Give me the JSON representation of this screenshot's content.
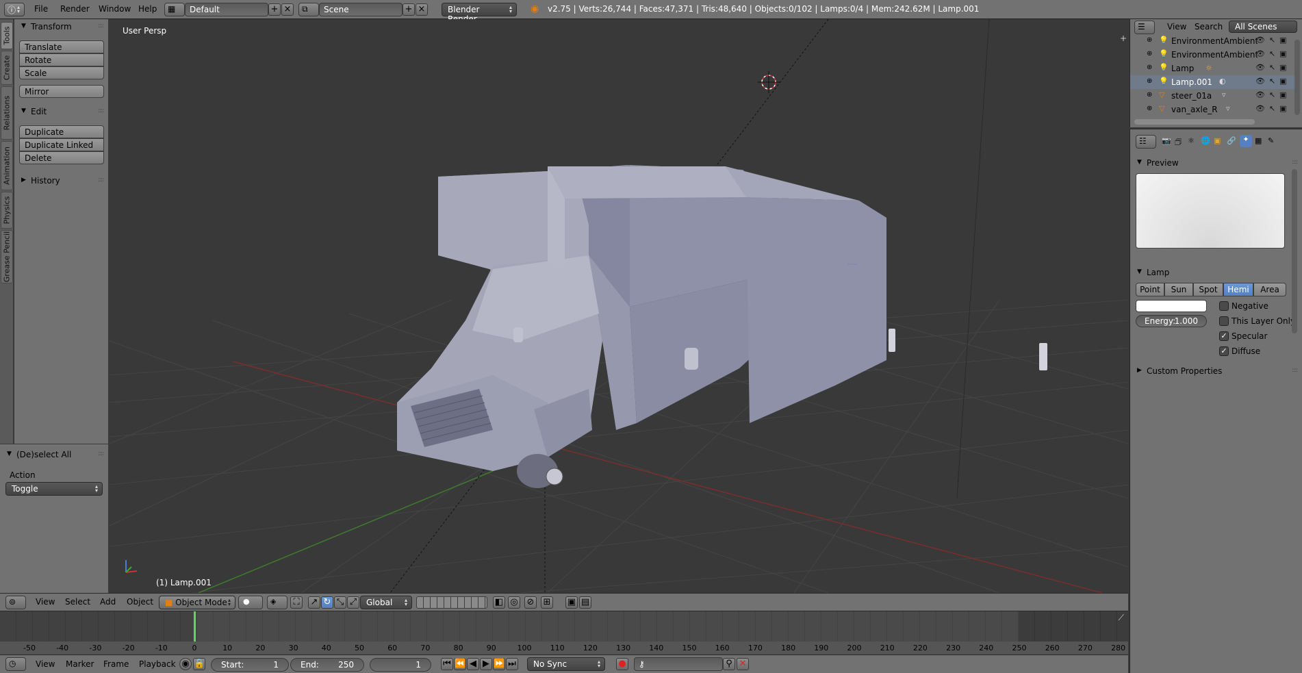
{
  "topbar": {
    "menus": [
      "File",
      "Render",
      "Window",
      "Help"
    ],
    "screen_layout": "Default",
    "scene": "Scene",
    "engine": "Blender Render",
    "stats": "v2.75 | Verts:26,744 | Faces:47,371 | Tris:48,640 | Objects:0/102 | Lamps:0/4 | Mem:242.62M | Lamp.001"
  },
  "left_tabs": [
    "Tools",
    "Create",
    "Relations",
    "Animation",
    "Physics",
    "Grease Pencil"
  ],
  "tool_panel": {
    "transform": {
      "title": "Transform",
      "buttons": [
        "Translate",
        "Rotate",
        "Scale",
        "Mirror"
      ]
    },
    "edit": {
      "title": "Edit",
      "buttons": [
        "Duplicate",
        "Duplicate Linked",
        "Delete"
      ]
    },
    "history": {
      "title": "History"
    }
  },
  "operator_panel": {
    "title": "(De)select All",
    "action_label": "Action",
    "action_value": "Toggle"
  },
  "viewport": {
    "view_name": "User Persp",
    "active_object": "(1) Lamp.001"
  },
  "view3d_header": {
    "menus": [
      "View",
      "Select",
      "Add",
      "Object"
    ],
    "mode": "Object Mode",
    "orientation": "Global"
  },
  "timeline": {
    "ticks": [
      "-50",
      "-40",
      "-30",
      "-20",
      "-10",
      "0",
      "10",
      "20",
      "30",
      "40",
      "50",
      "60",
      "70",
      "80",
      "90",
      "100",
      "110",
      "120",
      "130",
      "140",
      "150",
      "160",
      "170",
      "180",
      "190",
      "200",
      "210",
      "220",
      "230",
      "240",
      "250",
      "260",
      "270",
      "280"
    ],
    "current_frame_marker": 0
  },
  "timeline_header": {
    "menus": [
      "View",
      "Marker",
      "Frame",
      "Playback"
    ],
    "start_label": "Start:",
    "start_value": "1",
    "end_label": "End:",
    "end_value": "250",
    "current_frame": "1",
    "sync": "No Sync"
  },
  "outliner": {
    "header_menus": [
      "View",
      "Search"
    ],
    "scope": "All Scenes",
    "items": [
      {
        "name": "EnvironmentAmbientLi"
      },
      {
        "name": "EnvironmentAmbientLi"
      },
      {
        "name": "Lamp"
      },
      {
        "name": "Lamp.001"
      },
      {
        "name": "steer_01a"
      },
      {
        "name": "van_axle_R"
      }
    ]
  },
  "properties": {
    "preview_title": "Preview",
    "lamp_title": "Lamp",
    "lamp_types": [
      "Point",
      "Sun",
      "Spot",
      "Hemi",
      "Area"
    ],
    "active_lamp_type": "Hemi",
    "energy_label": "Energy:",
    "energy_value": "1.000",
    "checks": [
      {
        "label": "Negative",
        "checked": false
      },
      {
        "label": "This Layer Only",
        "checked": false
      },
      {
        "label": "Specular",
        "checked": true
      },
      {
        "label": "Diffuse",
        "checked": true
      }
    ],
    "custom_props_title": "Custom Properties"
  }
}
